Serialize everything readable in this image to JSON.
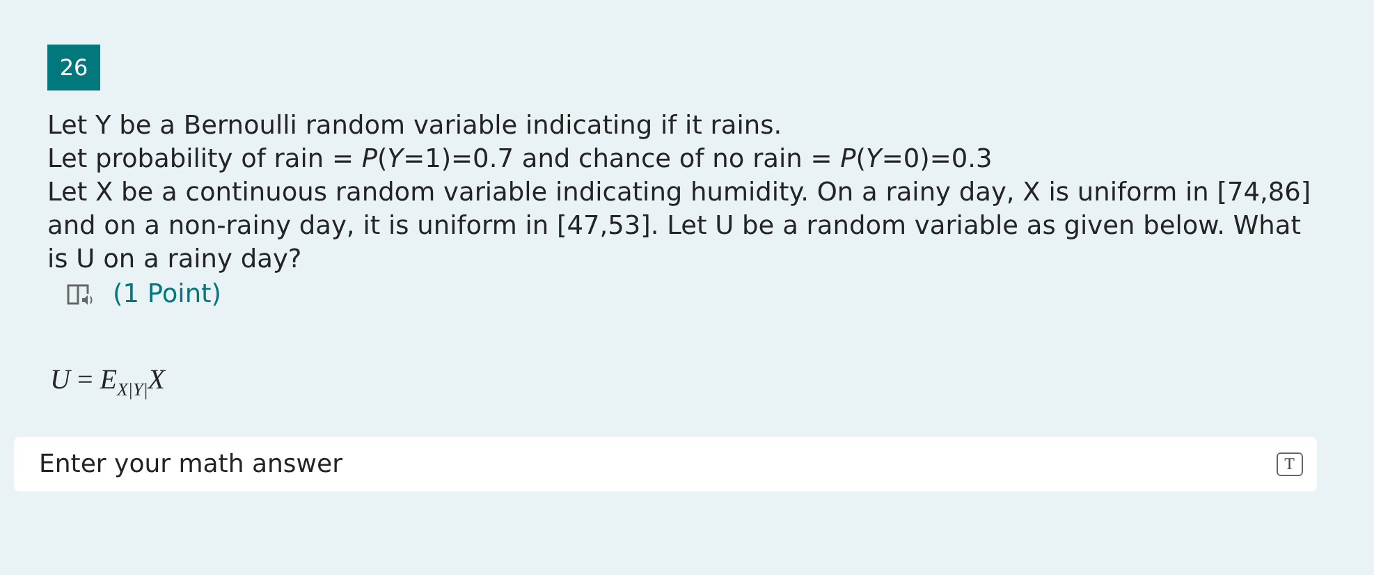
{
  "question": {
    "number": "26",
    "lines": [
      "Let Y be a Bernoulli random variable indicating if it rains.",
      "Let probability of rain = *P*(*Y*=1)=0.7 and chance of no rain = *P*(*Y*=0)=0.3",
      "Let X be a continuous random variable indicating humidity. On a rainy day, X is uniform in [74,86] and on a non-rainy day, it is uniform in [47,53]. Let U be a random variable as given below. What is U on a rainy day?"
    ],
    "points": "(1 Point)",
    "formula": "*U* = *E*$_{X|Y|}$*X*"
  },
  "answer": {
    "placeholder": "Enter your math answer",
    "format_button": "T"
  }
}
